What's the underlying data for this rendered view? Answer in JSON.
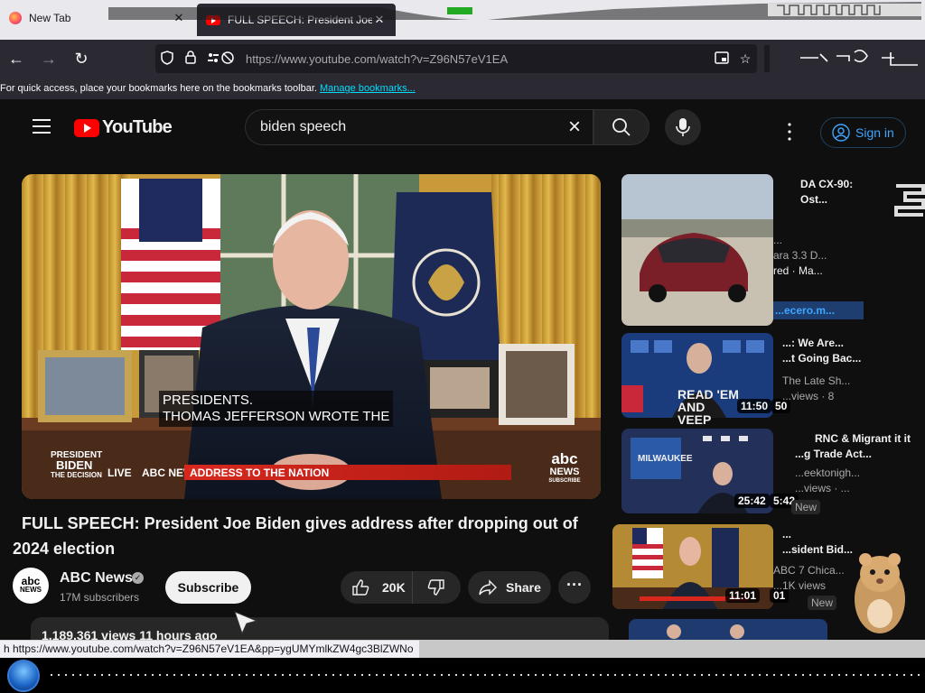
{
  "browser": {
    "tabs": [
      {
        "title": "New Tab",
        "close": "✕"
      },
      {
        "title": "FULL SPEECH: President Joe Bid",
        "close": "✕"
      }
    ],
    "url": "https://www.youtube.com/watch?v=Z96N57eV1EA",
    "bookmarks_text": "For quick access, place your bookmarks here on the bookmarks toolbar.",
    "bookmarks_link": "Manage bookmarks...",
    "status_url": "h https://www.youtube.com/watch?v=Z96N57eV1EA&pp=ygUMYmlkZW4gc3BlZWNo"
  },
  "youtube": {
    "logo_text": "YouTube",
    "search_query": "biden speech",
    "sign_in": "Sign in"
  },
  "video": {
    "captions": [
      "PRESIDENTS.",
      "THOMAS JEFFERSON WROTE THE"
    ],
    "lower_third": {
      "program_lines": [
        "PRESIDENT",
        "BIDEN",
        "THE DECISION"
      ],
      "live": "LIVE",
      "network": "ABC NEWS",
      "headline": "ADDRESS TO THE NATION",
      "bug": [
        "abc",
        "NEWS",
        "SUBSCRIBE"
      ]
    },
    "title": "FULL SPEECH: President Joe Biden gives address after dropping out of 2024 election",
    "channel": {
      "name": "ABC News",
      "subscribers": "17M subscribers",
      "avatar_text": [
        "abc",
        "NEWS"
      ]
    },
    "subscribe_label": "Subscribe",
    "likes": "20K",
    "share_label": "Share",
    "more_label": "···",
    "views_line": "1,189,361 views  11 hours ago"
  },
  "sidebar": [
    {
      "lines": [
        "DA CX-90:",
        "Ost...",
        "...",
        "ara 3.3 D...",
        "red · Ma..."
      ],
      "duration": "",
      "caption_lines": [
        "...ecero.m..."
      ]
    },
    {
      "lines": [
        "...: We Are...",
        "...t Going Bac...",
        "The Late Sh...",
        "...views · 8"
      ],
      "duration": "11:50",
      "dup_duration": "50",
      "overlay": "READ 'EM AND VEEP"
    },
    {
      "lines": [
        "RNC & Migrant it it",
        "...g Trade Act...",
        "...eektonigh...",
        "...views · ..."
      ],
      "duration": "25:42",
      "dup_duration": "5:42",
      "overlay": "MILWAUKEE",
      "badge": "New"
    },
    {
      "lines": [
        "...",
        "...sident Bid...",
        "ABC 7 Chica...",
        "...1K views"
      ],
      "duration": "11:01",
      "dup_duration": "01",
      "badge": "New"
    }
  ],
  "colors": {
    "yt_red": "#ff0000",
    "link_blue": "#3ea6ff",
    "bg": "#0f0f0f",
    "lower_third_red": "#d8281e"
  }
}
